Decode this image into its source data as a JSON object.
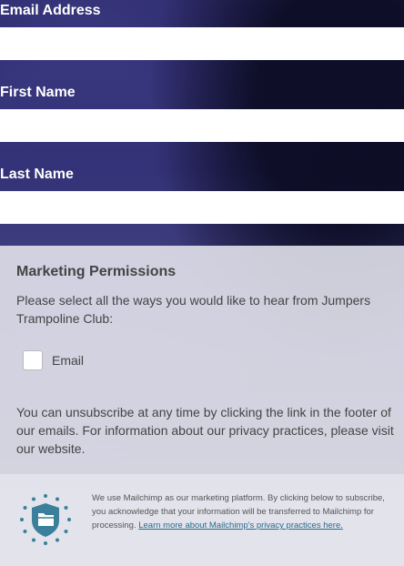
{
  "form": {
    "email_label": "Email Address",
    "first_name_label": "First Name",
    "last_name_label": "Last Name",
    "email_value": "",
    "first_name_value": "",
    "last_name_value": ""
  },
  "permissions": {
    "title": "Marketing Permissions",
    "description": "Please select all the ways you would like to hear from Jumpers Trampoline Club:",
    "options": [
      {
        "label": "Email",
        "checked": false
      }
    ],
    "unsubscribe_text": "You can unsubscribe at any time by clicking the link in the footer of our emails. For information about our privacy practices, please visit our website."
  },
  "footer": {
    "text": "We use Mailchimp as our marketing platform. By clicking below to subscribe, you acknowledge that your information will be transferred to Mailchimp for processing.",
    "link_text": "Learn more about Mailchimp's privacy practices here.",
    "logo_icon": "mailchimp-gdpr-shield-icon"
  },
  "colors": {
    "brand_dark": "#1e1b4a",
    "panel_bg": "#e1e1eb",
    "link": "#2a6a8a",
    "shield": "#3b7f9a"
  }
}
